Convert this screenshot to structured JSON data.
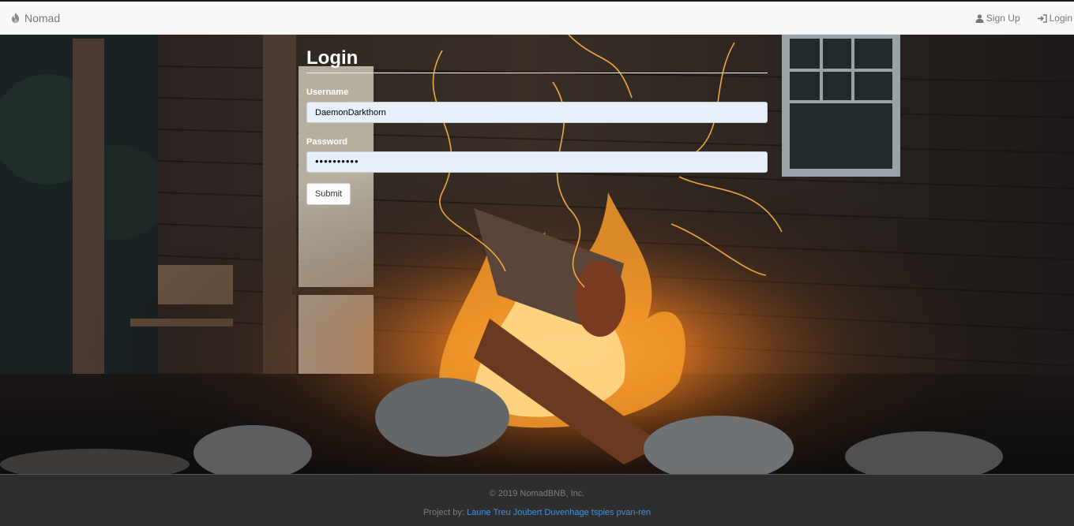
{
  "navbar": {
    "brand": "Nomad",
    "signup_label": "Sign Up",
    "login_label": "Login"
  },
  "form": {
    "title": "Login",
    "username_label": "Username",
    "username_value": "DaemonDarkthorn",
    "password_label": "Password",
    "password_masked": "••••••••••",
    "submit_label": "Submit"
  },
  "footer": {
    "copyright": "© 2019 NomadBNB, Inc.",
    "credits_prefix": "Project by:",
    "authors": [
      "Laune Treu",
      "Joubert Duvenhage",
      "tspies",
      "pvan-ren"
    ]
  },
  "colors": {
    "navbar_bg": "#f8f8f8",
    "input_bg": "#e8f0fe",
    "footer_bg": "#2e2e2e",
    "link": "#4d8fd6"
  },
  "icons": {
    "brand": "flame-icon",
    "signup": "user-icon",
    "login": "log-in-icon"
  }
}
